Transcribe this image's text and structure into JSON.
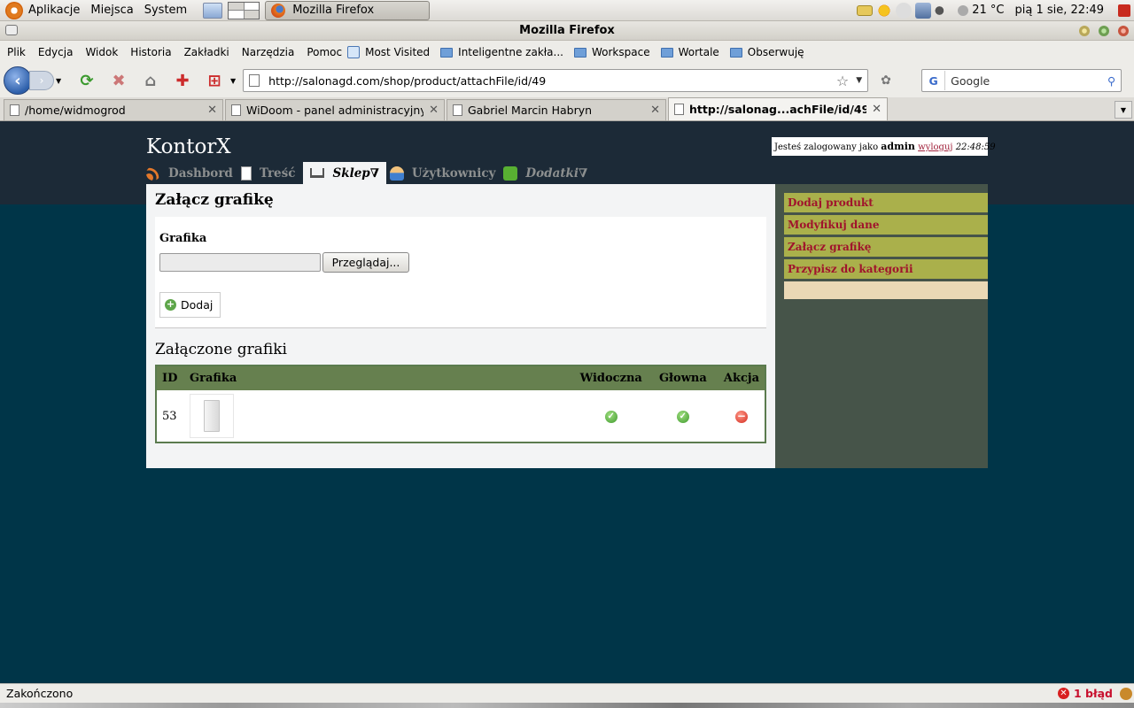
{
  "gnome_panel": {
    "menus": [
      "Aplikacje",
      "Miejsca",
      "System"
    ],
    "task": "Mozilla Firefox",
    "weather": "21 °C",
    "clock": "pią  1 sie, 22:49"
  },
  "window": {
    "title": "Mozilla Firefox"
  },
  "menubar": {
    "items": [
      "Plik",
      "Edycja",
      "Widok",
      "Historia",
      "Zakładki",
      "Narzędzia",
      "Pomoc"
    ],
    "bookmarks": [
      "Most Visited",
      "Inteligentne zakła...",
      "Workspace",
      "Wortale",
      "Obserwuję"
    ]
  },
  "navbar": {
    "url": "http://salonagd.com/shop/product/attachFile/id/49",
    "search_placeholder": "Google"
  },
  "tabs": [
    {
      "title": "/home/widmogrod"
    },
    {
      "title": "WiDoom - panel administracyjny"
    },
    {
      "title": "Gabriel Marcin Habryn"
    },
    {
      "title": "http://salonag...achFile/id/49"
    }
  ],
  "site": {
    "title": "KontorX",
    "login": {
      "prefix": "Jesteś zalogowany jako",
      "user": "admin",
      "logout": "wyloguj",
      "time": "22:48:59"
    },
    "nav": [
      {
        "label": "Dashbord",
        "icon": "rss-icon"
      },
      {
        "label": "Treść",
        "icon": "document-icon"
      },
      {
        "label": "Sklep∇",
        "icon": "cart-icon",
        "active": true
      },
      {
        "label": "Użytkownicy",
        "icon": "user-icon"
      },
      {
        "label": "Dodatki∇",
        "icon": "puzzle-icon"
      }
    ]
  },
  "main": {
    "heading": "Załącz grafikę",
    "form": {
      "label": "Grafika",
      "browse": "Przeglądaj...",
      "submit": "Dodaj"
    },
    "attached_heading": "Załączone grafiki",
    "table": {
      "headers": [
        "ID",
        "Grafika",
        "Widoczna",
        "Głowna",
        "Akcja"
      ],
      "rows": [
        {
          "id": "53",
          "visible": "check-icon",
          "main": "check-icon",
          "action": "delete-icon"
        }
      ]
    }
  },
  "sidebar": {
    "items": [
      "Dodaj produkt",
      "Modyfikuj dane",
      "Załącz grafikę",
      "Przypisz do kategorii"
    ]
  },
  "statusbar": {
    "status": "Zakończono",
    "errors": "1 błąd"
  }
}
